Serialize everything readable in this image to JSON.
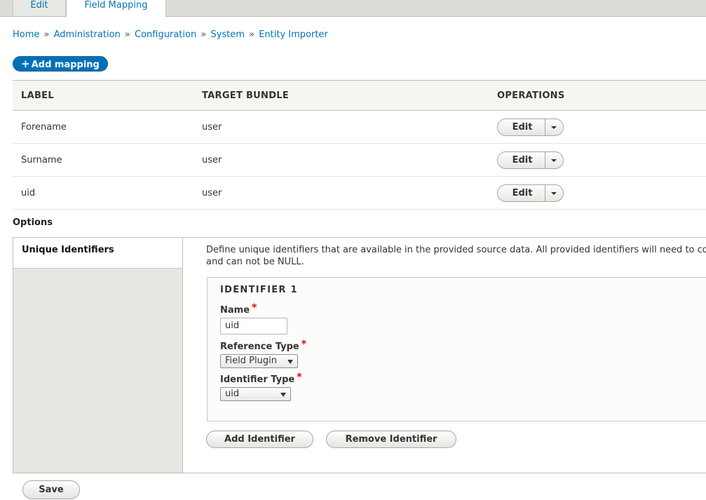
{
  "tabs": [
    {
      "label": "Edit",
      "active": false
    },
    {
      "label": "Field Mapping",
      "active": true
    }
  ],
  "breadcrumb": [
    "Home",
    "Administration",
    "Configuration",
    "System",
    "Entity Importer"
  ],
  "breadcrumb_separator": "»",
  "add_button": {
    "icon": "plus-icon",
    "plus": "+",
    "label": "Add mapping"
  },
  "table": {
    "headers": [
      "LABEL",
      "TARGET BUNDLE",
      "OPERATIONS"
    ],
    "rows": [
      {
        "label": "Forename",
        "bundle": "user",
        "op": "Edit"
      },
      {
        "label": "Surname",
        "bundle": "user",
        "op": "Edit"
      },
      {
        "label": "uid",
        "bundle": "user",
        "op": "Edit"
      }
    ]
  },
  "options": {
    "heading": "Options",
    "vertical_tab": "Unique Identifiers",
    "description_line1": "Define unique identifiers that are available in the provided source data. All provided identifiers will need to co",
    "description_line2": "and can not be NULL.",
    "fieldset": {
      "legend": "IDENTIFIER 1",
      "name_label": "Name",
      "name_value": "uid",
      "reference_type_label": "Reference Type",
      "reference_type_value": "Field Plugin",
      "identifier_type_label": "Identifier Type",
      "identifier_type_value": "uid",
      "required_mark": "*"
    },
    "add_identifier": "Add Identifier",
    "remove_identifier": "Remove Identifier"
  },
  "save_label": "Save",
  "colors": {
    "link": "#0074bd",
    "primary": "#0071b8",
    "required": "#e00000"
  }
}
